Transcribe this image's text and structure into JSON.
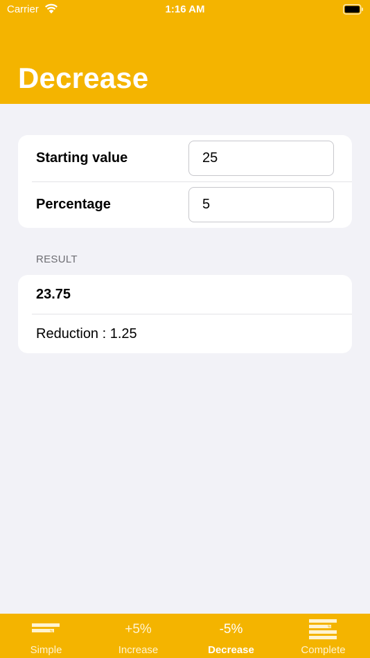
{
  "status_bar": {
    "carrier": "Carrier",
    "time": "1:16 AM"
  },
  "header": {
    "title": "Decrease"
  },
  "form": {
    "starting_value_label": "Starting value",
    "starting_value": "25",
    "percentage_label": "Percentage",
    "percentage": "5"
  },
  "result": {
    "section_header": "RESULT",
    "value": "23.75",
    "reduction": "Reduction : 1.25"
  },
  "tabs": [
    {
      "label": "Simple",
      "icon": "simple-percent-icon",
      "active": false
    },
    {
      "label": "Increase",
      "icon_text": "+5%",
      "active": false
    },
    {
      "label": "Decrease",
      "icon_text": "-5%",
      "active": true
    },
    {
      "label": "Complete",
      "icon": "complete-percent-icon",
      "active": false
    }
  ],
  "colors": {
    "accent": "#F4B400",
    "background": "#F2F2F7"
  }
}
